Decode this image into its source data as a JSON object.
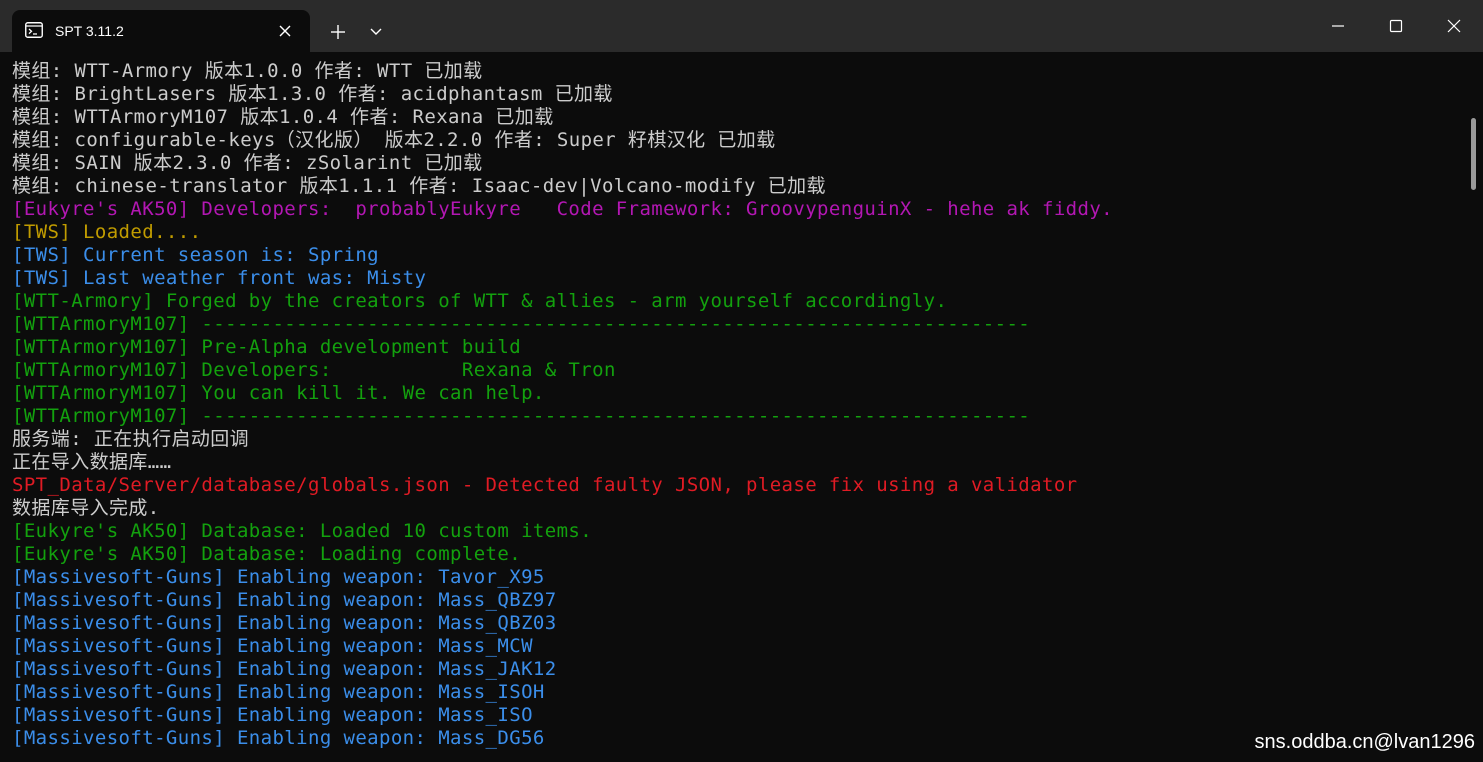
{
  "window": {
    "tab_title": "SPT 3.11.2"
  },
  "colors": {
    "white": "#cccccc",
    "magenta": "#b317b3",
    "gold": "#c19c00",
    "blue": "#3b8eea",
    "green": "#13a10e",
    "red": "#e01b24"
  },
  "icons": {
    "tab": "terminal-icon",
    "close_tab": "close-icon",
    "new_tab": "plus-icon",
    "dropdown": "chevron-down-icon",
    "minimize": "minimize-icon",
    "maximize": "maximize-icon",
    "close_window": "close-icon"
  },
  "terminal": {
    "lines": [
      {
        "text": "模组: WTT-Armory 版本1.0.0 作者: WTT 已加载",
        "color": "#cccccc"
      },
      {
        "text": "模组: BrightLasers 版本1.3.0 作者: acidphantasm 已加载",
        "color": "#cccccc"
      },
      {
        "text": "模组: WTTArmoryM107 版本1.0.4 作者: Rexana 已加载",
        "color": "#cccccc"
      },
      {
        "text": "模组: configurable-keys（汉化版） 版本2.2.0 作者: Super 籽棋汉化 已加载",
        "color": "#cccccc"
      },
      {
        "text": "模组: SAIN 版本2.3.0 作者: zSolarint 已加载",
        "color": "#cccccc"
      },
      {
        "text": "模组: chinese-translator 版本1.1.1 作者: Isaac-dev|Volcano-modify 已加载",
        "color": "#cccccc"
      },
      {
        "text": "[Eukyre's AK50] Developers:  probablyEukyre   Code Framework: GroovypenguinX - hehe ak fiddy.",
        "color": "#b317b3"
      },
      {
        "text": "[TWS] Loaded....",
        "color": "#c19c00"
      },
      {
        "text": "[TWS] Current season is: Spring",
        "color": "#3b8eea"
      },
      {
        "text": "[TWS] Last weather front was: Misty",
        "color": "#3b8eea"
      },
      {
        "text": "[WTT-Armory] Forged by the creators of WTT & allies - arm yourself accordingly.",
        "color": "#13a10e"
      },
      {
        "text": "[WTTArmoryM107] ----------------------------------------------------------------------",
        "color": "#13a10e"
      },
      {
        "text": "[WTTArmoryM107] Pre-Alpha development build",
        "color": "#13a10e"
      },
      {
        "text": "[WTTArmoryM107] Developers:           Rexana & Tron",
        "color": "#13a10e"
      },
      {
        "text": "[WTTArmoryM107] You can kill it. We can help.",
        "color": "#13a10e"
      },
      {
        "text": "[WTTArmoryM107] ----------------------------------------------------------------------",
        "color": "#13a10e"
      },
      {
        "text": "服务端: 正在执行启动回调",
        "color": "#cccccc"
      },
      {
        "text": "正在导入数据库……",
        "color": "#cccccc"
      },
      {
        "text": "SPT_Data/Server/database/globals.json - Detected faulty JSON, please fix using a validator",
        "color": "#e01b24"
      },
      {
        "text": "数据库导入完成.",
        "color": "#cccccc"
      },
      {
        "text": "[Eukyre's AK50] Database: Loaded 10 custom items.",
        "color": "#13a10e"
      },
      {
        "text": "[Eukyre's AK50] Database: Loading complete.",
        "color": "#13a10e"
      },
      {
        "text": "[Massivesoft-Guns] Enabling weapon: Tavor_X95",
        "color": "#3b8eea"
      },
      {
        "text": "[Massivesoft-Guns] Enabling weapon: Mass_QBZ97",
        "color": "#3b8eea"
      },
      {
        "text": "[Massivesoft-Guns] Enabling weapon: Mass_QBZ03",
        "color": "#3b8eea"
      },
      {
        "text": "[Massivesoft-Guns] Enabling weapon: Mass_MCW",
        "color": "#3b8eea"
      },
      {
        "text": "[Massivesoft-Guns] Enabling weapon: Mass_JAK12",
        "color": "#3b8eea"
      },
      {
        "text": "[Massivesoft-Guns] Enabling weapon: Mass_ISOH",
        "color": "#3b8eea"
      },
      {
        "text": "[Massivesoft-Guns] Enabling weapon: Mass_ISO",
        "color": "#3b8eea"
      },
      {
        "text": "[Massivesoft-Guns] Enabling weapon: Mass_DG56",
        "color": "#3b8eea"
      }
    ]
  },
  "watermark": "sns.oddba.cn@lvan1296"
}
